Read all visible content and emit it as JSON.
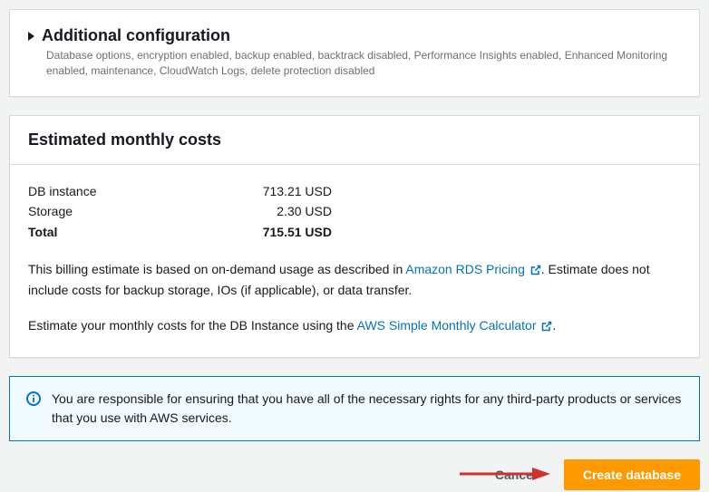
{
  "config": {
    "title": "Additional configuration",
    "description": "Database options, encryption enabled, backup enabled, backtrack disabled, Performance Insights enabled, Enhanced Monitoring enabled, maintenance, CloudWatch Logs, delete protection disabled"
  },
  "costs": {
    "title": "Estimated monthly costs",
    "rows": [
      {
        "label": "DB instance",
        "value": "713.21 USD"
      },
      {
        "label": "Storage",
        "value": "2.30 USD"
      }
    ],
    "total": {
      "label": "Total",
      "value": "715.51 USD"
    },
    "disclaimer_before_link": "This billing estimate is based on on-demand usage as described in ",
    "disclaimer_link": "Amazon RDS Pricing",
    "disclaimer_after_link": ". Estimate does not include costs for backup storage, IOs (if applicable), or data transfer.",
    "estimate_before_link": "Estimate your monthly costs for the DB Instance using the ",
    "estimate_link": "AWS Simple Monthly Calculator",
    "estimate_after_link": "."
  },
  "notice": {
    "text": "You are responsible for ensuring that you have all of the necessary rights for any third-party products or services that you use with AWS services."
  },
  "actions": {
    "cancel": "Cancel",
    "create": "Create database"
  }
}
